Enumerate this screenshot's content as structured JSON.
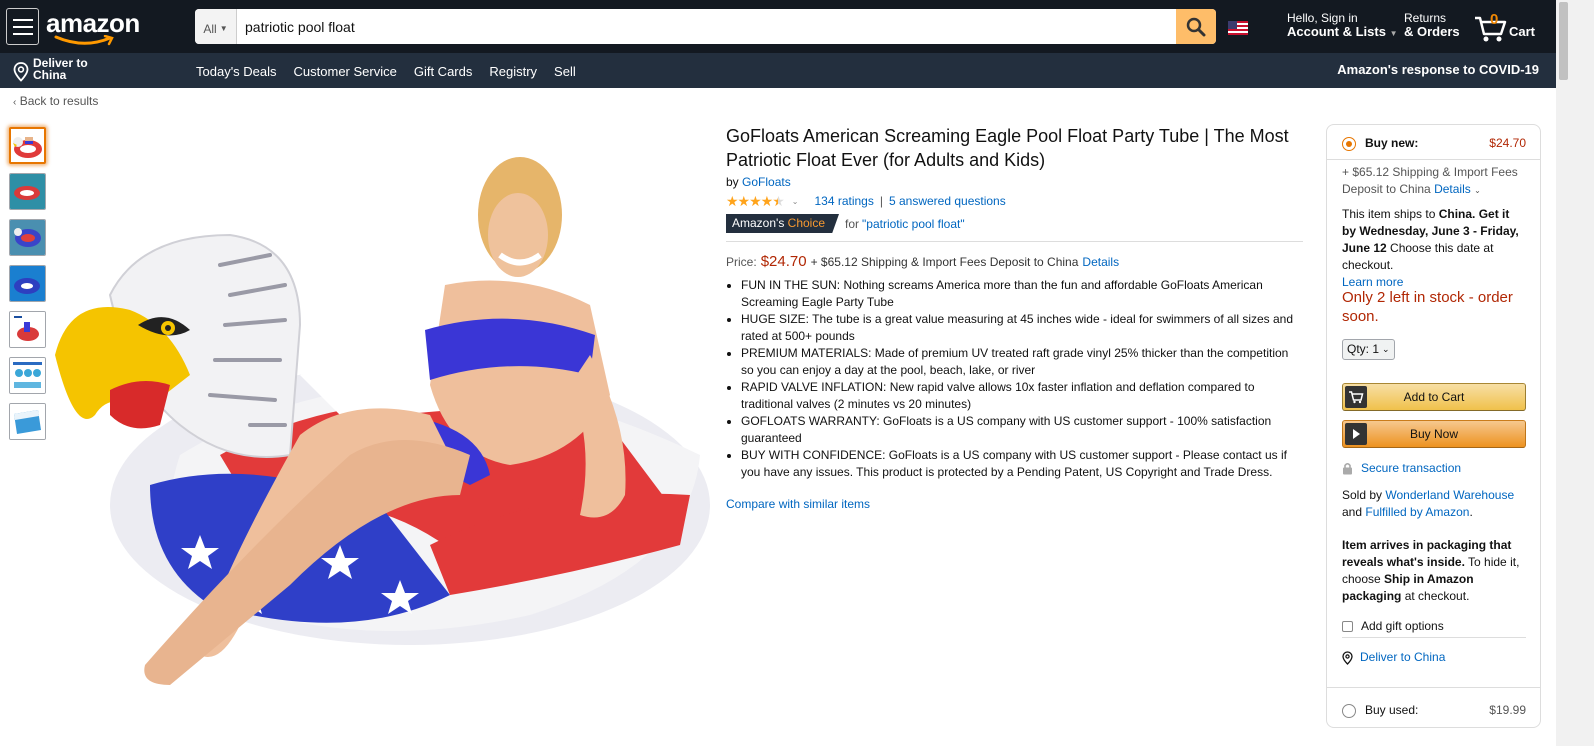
{
  "header": {
    "logo": "amazon",
    "search_category": "All",
    "search_value": "patriotic pool float",
    "account_line1": "Hello, Sign in",
    "account_line2": "Account & Lists",
    "returns_line1": "Returns",
    "returns_line2": "& Orders",
    "cart_count": "0",
    "cart_label": "Cart"
  },
  "subnav": {
    "deliver_line1": "Deliver to",
    "deliver_line2": "China",
    "links": [
      "Today's Deals",
      "Customer Service",
      "Gift Cards",
      "Registry",
      "Sell"
    ],
    "covid": "Amazon's response to COVID-19"
  },
  "back_link": "Back to results",
  "product": {
    "title": "GoFloats American Screaming Eagle Pool Float Party Tube | The Most Patriotic Float Ever (for Adults and Kids)",
    "by": "by",
    "brand": "GoFloats",
    "rating_stars": 4.5,
    "ratings_count": "134 ratings",
    "separator": "|",
    "questions": "5 answered questions",
    "badge_prefix": "Amazon's",
    "badge_suffix": "Choice",
    "badge_for": "for",
    "badge_query": "\"patriotic pool float\"",
    "price_label": "Price:",
    "price": "$24.70",
    "shipping": "+ $65.12 Shipping & Import Fees Deposit to China",
    "shipping_details": "Details",
    "bullets": [
      "FUN IN THE SUN: Nothing screams America more than the fun and affordable GoFloats American Screaming Eagle Party Tube",
      "HUGE SIZE: The tube is a great value measuring at 45 inches wide - ideal for swimmers of all sizes and rated at 500+ pounds",
      "PREMIUM MATERIALS: Made of premium UV treated raft grade vinyl 25% thicker than the competition so you can enjoy a day at the pool, beach, lake, or river",
      "RAPID VALVE INFLATION: New rapid valve allows 10x faster inflation and deflation compared to traditional valves (2 minutes vs 20 minutes)",
      "GOFLOATS WARRANTY: GoFloats is a US company with US customer support - 100% satisfaction guaranteed",
      "BUY WITH CONFIDENCE: GoFloats is a US company with US customer support - Please contact us if you have any issues. This product is protected by a Pending Patent, US Copyright and Trade Dress."
    ],
    "compare_link": "Compare with similar items"
  },
  "buybox": {
    "buy_new_label": "Buy new:",
    "buy_new_price": "$24.70",
    "shipping_line": "+ $65.12 Shipping & Import Fees Deposit to China",
    "shipping_details": "Details",
    "ships_to_pre": "This item ships to ",
    "ships_to_country": "China",
    "get_it_pre": ". Get it by",
    "get_it_dates": "Wednesday, June 3 - Friday, June 12",
    "choose_date": " Choose this date at checkout.",
    "learn_more": "Learn more",
    "stock": "Only 2 left in stock - order soon.",
    "qty_label": "Qty: 1",
    "add_to_cart": "Add to Cart",
    "buy_now": "Buy Now",
    "secure": "Secure transaction",
    "sold_by": "Sold by",
    "seller": "Wonderland Warehouse",
    "and": "and",
    "fulfilled": "Fulfilled by Amazon",
    "period": ".",
    "packaging_bold": "Item arrives in packaging that reveals what's inside.",
    "packaging_rest": " To hide it, choose ",
    "packaging_bold2": "Ship in Amazon packaging",
    "packaging_end": " at checkout.",
    "gift_options": "Add gift options",
    "deliver_to": "Deliver to China",
    "buy_used_label": "Buy used:",
    "buy_used_price": "$19.99"
  },
  "colors": {
    "nav_dark": "#131921",
    "nav_sub": "#232f3e",
    "link": "#0066c0",
    "price": "#b12704",
    "accent": "#febd69"
  }
}
